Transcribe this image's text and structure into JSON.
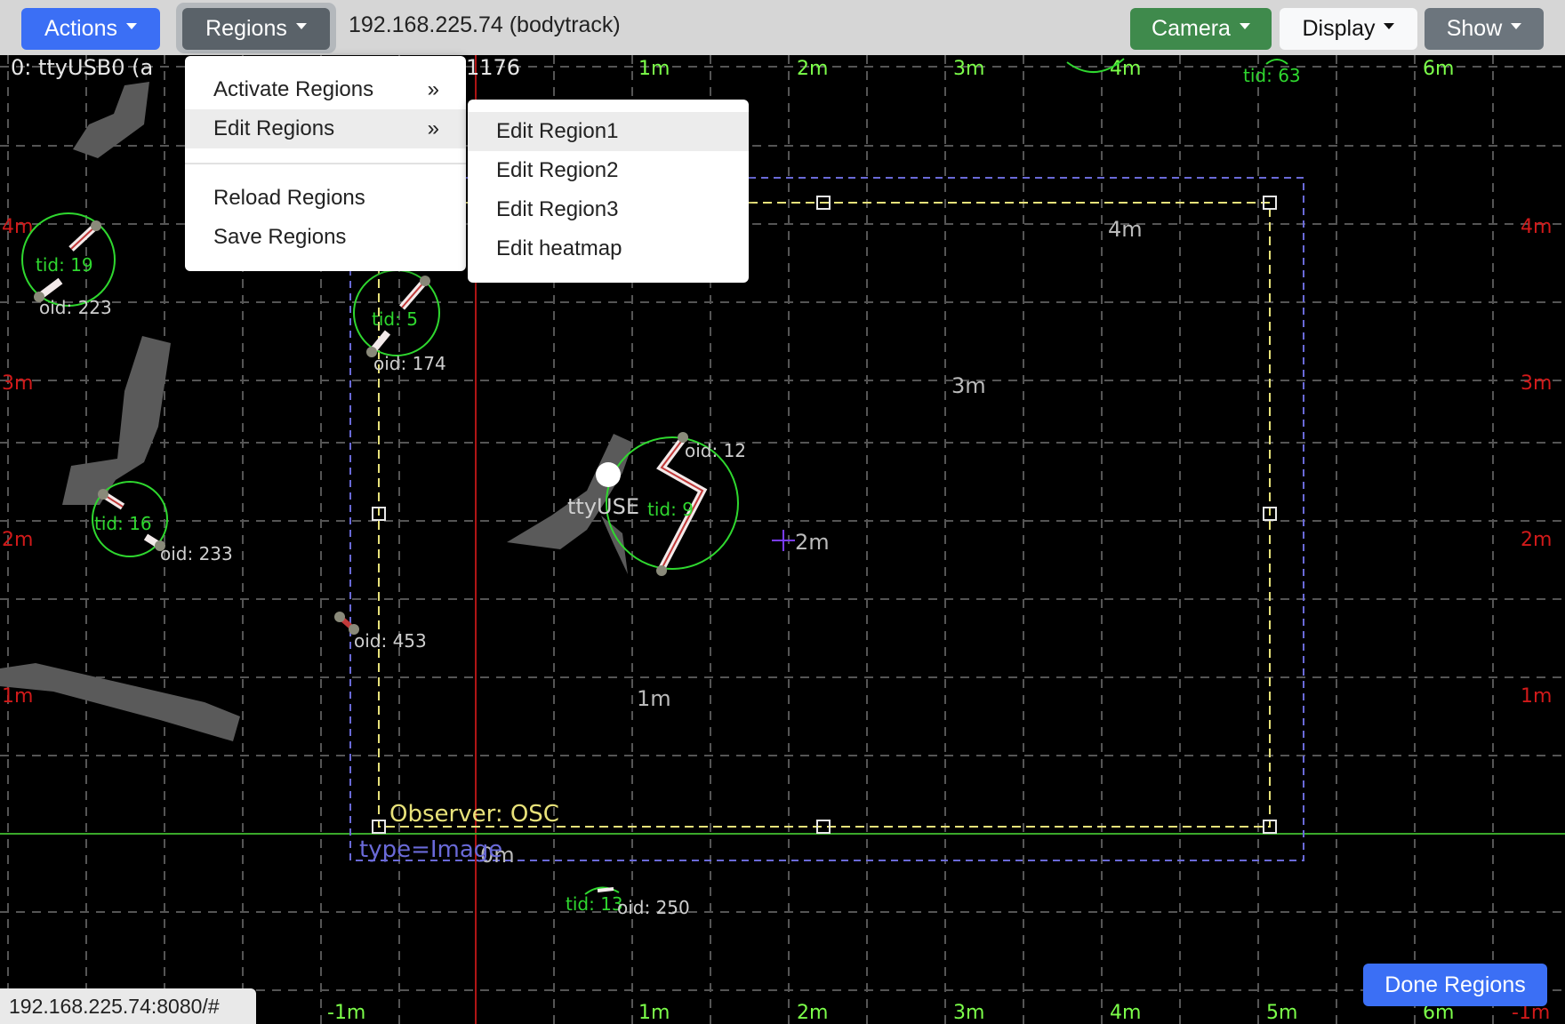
{
  "toolbar": {
    "actions_label": "Actions",
    "regions_label": "Regions",
    "host_label": "192.168.225.74 (bodytrack)",
    "camera_label": "Camera",
    "display_label": "Display",
    "show_label": "Show"
  },
  "regions_menu": {
    "items": [
      {
        "label": "Activate Regions",
        "arrow": "»"
      },
      {
        "label": "Edit Regions",
        "arrow": "»"
      },
      {
        "label": "Reload Regions"
      },
      {
        "label": "Save Regions"
      }
    ]
  },
  "edit_submenu": {
    "items": [
      "Edit Region1",
      "Edit Region2",
      "Edit Region3",
      "Edit heatmap"
    ]
  },
  "viz": {
    "sensor_label": "0: ttyUSB0 (a",
    "sensor_label_tail": "1176",
    "sensor_center_label": "ttyUSE",
    "observer_label": "Observer: OSC",
    "region_type_label": "type=Image",
    "grid_top_labels": [
      "1m",
      "2m",
      "3m",
      "4m",
      "6m"
    ],
    "grid_bottom_labels": [
      "-1m",
      "1m",
      "2m",
      "3m",
      "4m",
      "5m",
      "6m",
      "-1m"
    ],
    "grid_left_labels": [
      "4m",
      "3m",
      "2m",
      "1m"
    ],
    "grid_right_labels": [
      "4m",
      "3m",
      "2m",
      "1m"
    ],
    "range_labels": [
      "4m",
      "3m",
      "2m",
      "1m",
      "0m"
    ],
    "tracks": [
      {
        "tid": "tid: 19",
        "oid": "oid: 223"
      },
      {
        "tid": "tid: 5",
        "oid": "oid: 174"
      },
      {
        "tid": "tid: 16",
        "oid": "oid: 233"
      },
      {
        "tid": "tid: 9",
        "oid": "oid: 12"
      },
      {
        "tid": "tid: 63",
        "oid": ""
      },
      {
        "tid": "tid: 13",
        "oid": "oid: 250"
      },
      {
        "tid": "",
        "oid": "oid: 453"
      }
    ]
  },
  "done_label": "Done Regions",
  "status_url": "192.168.225.74:8080/#",
  "colors": {
    "actions_btn": "#3b6ff5",
    "regions_btn": "#5a6269",
    "camera_btn": "#3f8a4c",
    "show_btn": "#6c757d",
    "done_btn": "#3b6ff5",
    "grid_label_green": "#7cff4a",
    "grid_label_red": "#d11a1a",
    "region_yellow": "#e8e27a",
    "region_blue": "#6a6ad8"
  }
}
